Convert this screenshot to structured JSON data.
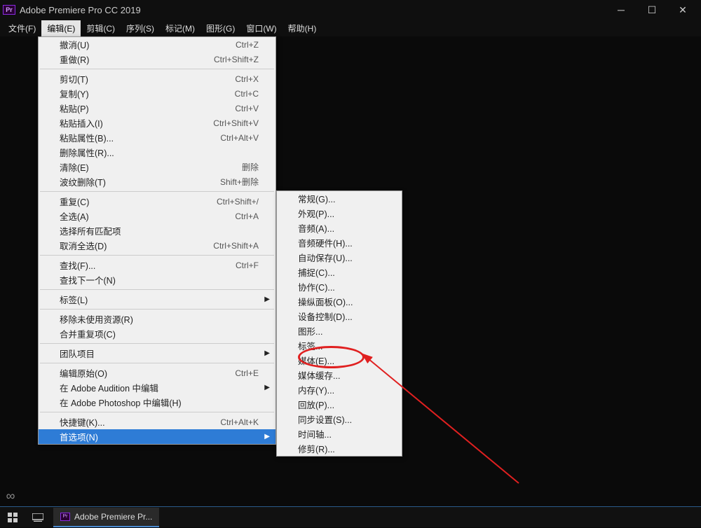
{
  "title": "Adobe Premiere Pro CC 2019",
  "app_icon": "Pr",
  "menubar": [
    "文件(F)",
    "编辑(E)",
    "剪辑(C)",
    "序列(S)",
    "标记(M)",
    "图形(G)",
    "窗口(W)",
    "帮助(H)"
  ],
  "active_menu_index": 1,
  "edit_menu": [
    {
      "label": "撤消(U)",
      "shortcut": "Ctrl+Z"
    },
    {
      "label": "重做(R)",
      "shortcut": "Ctrl+Shift+Z"
    },
    {
      "sep": true
    },
    {
      "label": "剪切(T)",
      "shortcut": "Ctrl+X"
    },
    {
      "label": "复制(Y)",
      "shortcut": "Ctrl+C"
    },
    {
      "label": "粘贴(P)",
      "shortcut": "Ctrl+V"
    },
    {
      "label": "粘贴插入(I)",
      "shortcut": "Ctrl+Shift+V"
    },
    {
      "label": "粘贴属性(B)...",
      "shortcut": "Ctrl+Alt+V"
    },
    {
      "label": "删除属性(R)...",
      "shortcut": ""
    },
    {
      "label": "清除(E)",
      "shortcut": "删除"
    },
    {
      "label": "波纹删除(T)",
      "shortcut": "Shift+删除"
    },
    {
      "sep": true
    },
    {
      "label": "重复(C)",
      "shortcut": "Ctrl+Shift+/"
    },
    {
      "label": "全选(A)",
      "shortcut": "Ctrl+A"
    },
    {
      "label": "选择所有匹配项",
      "shortcut": ""
    },
    {
      "label": "取消全选(D)",
      "shortcut": "Ctrl+Shift+A"
    },
    {
      "sep": true
    },
    {
      "label": "查找(F)...",
      "shortcut": "Ctrl+F"
    },
    {
      "label": "查找下一个(N)",
      "shortcut": ""
    },
    {
      "sep": true
    },
    {
      "label": "标签(L)",
      "shortcut": "",
      "has_sub": true
    },
    {
      "sep": true
    },
    {
      "label": "移除未使用资源(R)",
      "shortcut": ""
    },
    {
      "label": "合并重复项(C)",
      "shortcut": ""
    },
    {
      "sep": true
    },
    {
      "label": "团队项目",
      "shortcut": "",
      "has_sub": true
    },
    {
      "sep": true
    },
    {
      "label": "编辑原始(O)",
      "shortcut": "Ctrl+E"
    },
    {
      "label": "在 Adobe Audition 中编辑",
      "shortcut": "",
      "has_sub": true
    },
    {
      "label": "在 Adobe Photoshop 中编辑(H)",
      "shortcut": ""
    },
    {
      "sep": true
    },
    {
      "label": "快捷键(K)...",
      "shortcut": "Ctrl+Alt+K"
    },
    {
      "label": "首选项(N)",
      "shortcut": "",
      "has_sub": true,
      "highlight": true
    }
  ],
  "pref_submenu": [
    "常规(G)...",
    "外观(P)...",
    "音频(A)...",
    "音频硬件(H)...",
    "自动保存(U)...",
    "捕捉(C)...",
    "协作(C)...",
    "操纵面板(O)...",
    "设备控制(D)...",
    "图形...",
    "标签...",
    "媒体(E)...",
    "媒体缓存...",
    "内存(Y)...",
    "回放(P)...",
    "同步设置(S)...",
    "时间轴...",
    "修剪(R)..."
  ],
  "highlighted_sub_index": 12,
  "taskbar_app": "Adobe Premiere Pr..."
}
